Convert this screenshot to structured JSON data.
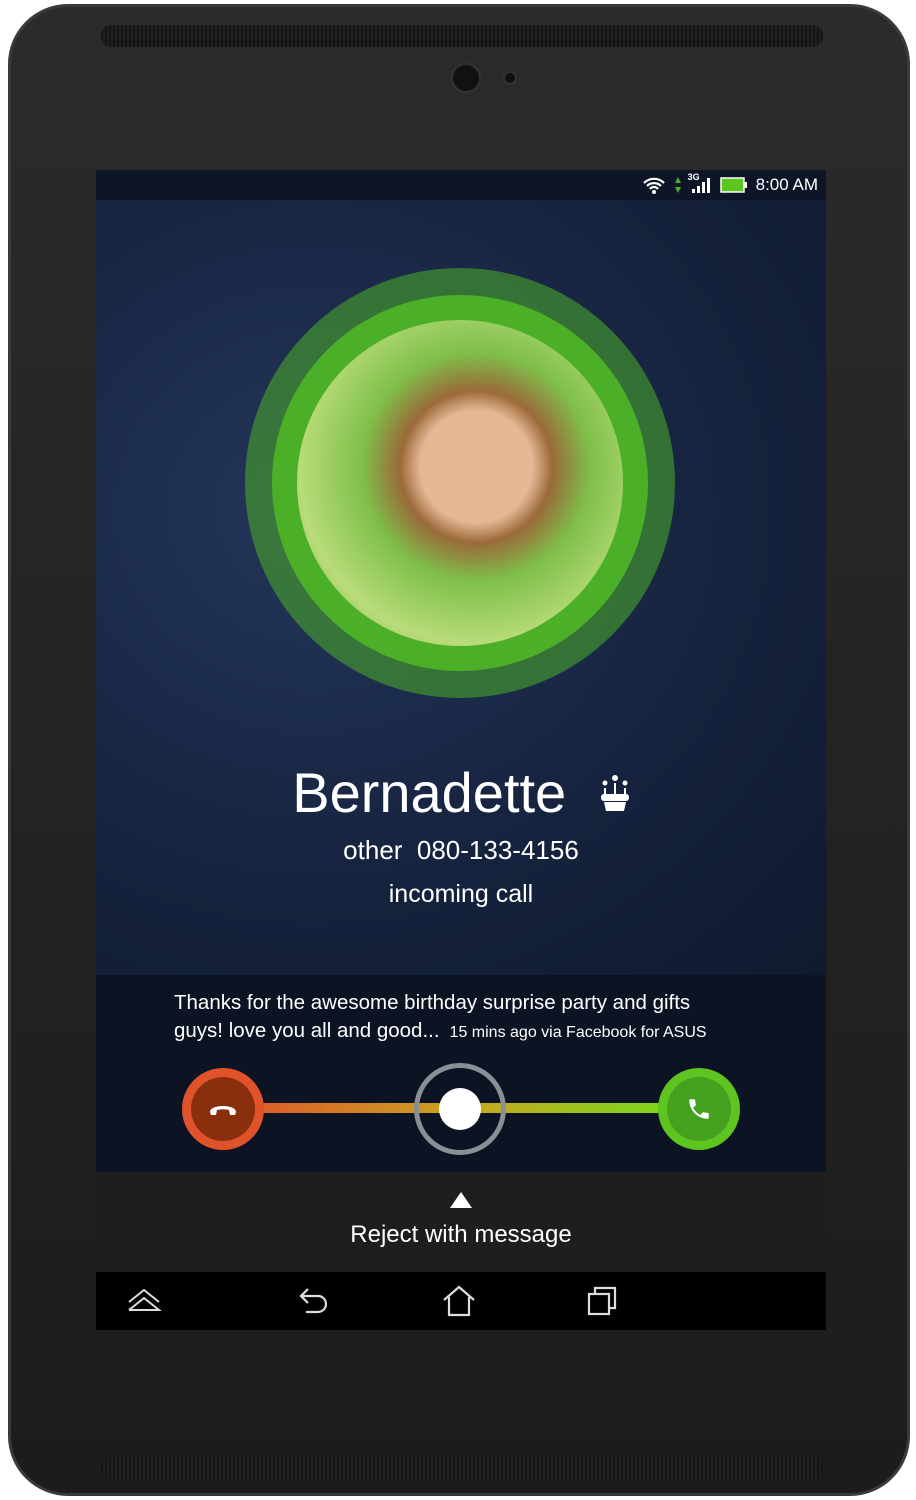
{
  "status_bar": {
    "time": "8:00 AM",
    "network": "3G",
    "icons": [
      "wifi-icon",
      "data-arrows-icon",
      "signal-icon",
      "battery-icon"
    ]
  },
  "caller": {
    "name": "Bernadette",
    "name_icon": "birthday-cake-icon",
    "label": "other",
    "number": "080-133-4156",
    "state": "incoming call"
  },
  "social": {
    "message_line1": "Thanks for the awesome birthday surprise party and gifts",
    "message_line2": "guys! love you all and good...",
    "meta": "15 mins ago via Facebook for ASUS"
  },
  "controls": {
    "decline_icon": "phone-hangup-icon",
    "answer_icon": "phone-icon",
    "colors": {
      "decline": "#e0522a",
      "answer": "#4caf28"
    }
  },
  "reject": {
    "label": "Reject with message"
  },
  "nav": {
    "icons": [
      "chevron-up-icon",
      "back-icon",
      "home-icon",
      "recents-icon"
    ]
  }
}
